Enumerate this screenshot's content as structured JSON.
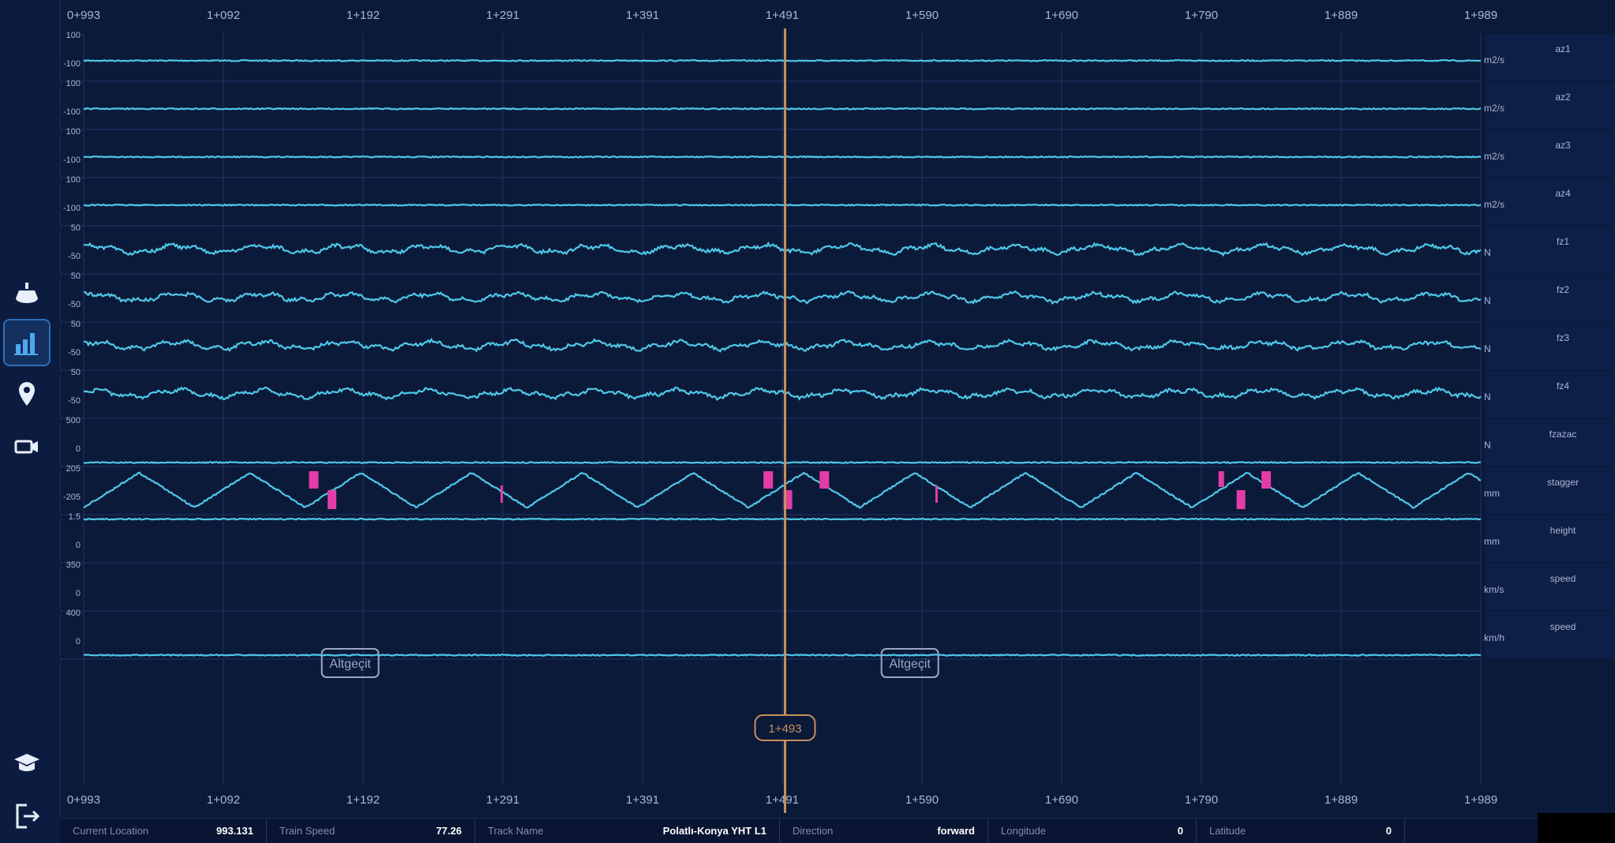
{
  "sidebar": {
    "items": [
      {
        "name": "hull-icon",
        "active": false
      },
      {
        "name": "bar-chart-icon",
        "active": true
      },
      {
        "name": "location-pin-icon",
        "active": false
      },
      {
        "name": "camera-icon",
        "active": false
      },
      {
        "name": "graduation-cap-icon",
        "active": false
      },
      {
        "name": "logout-icon",
        "active": false
      }
    ]
  },
  "colors": {
    "background": "#0c1a3a",
    "signal": "#4fc8e6",
    "cursor": "#c8905a",
    "highlight": "#e23ca6",
    "grid": "#1e3464",
    "text": "#aab6d2"
  },
  "chart_data": {
    "type": "line",
    "x_ticks": [
      "0+993",
      "1+092",
      "1+192",
      "1+291",
      "1+391",
      "1+491",
      "1+590",
      "1+690",
      "1+790",
      "1+889",
      "1+989"
    ],
    "xlim": [
      993,
      1989
    ],
    "cursor": {
      "position": 1493,
      "label": "1+493"
    },
    "annotations": [
      {
        "label": "Altgeçit",
        "position": 1183
      },
      {
        "label": "Altgeçit",
        "position": 1582
      }
    ],
    "tracks": [
      {
        "name": "az1",
        "unit": "m2/s",
        "tick_top": "100",
        "tick_bottom": "-100",
        "style": "flat",
        "baseline": 0.6
      },
      {
        "name": "az2",
        "unit": "m2/s",
        "tick_top": "100",
        "tick_bottom": "-100",
        "style": "flat",
        "baseline": 0.6
      },
      {
        "name": "az3",
        "unit": "m2/s",
        "tick_top": "100",
        "tick_bottom": "-100",
        "style": "flat",
        "baseline": 0.6
      },
      {
        "name": "az4",
        "unit": "m2/s",
        "tick_top": "100",
        "tick_bottom": "-100",
        "style": "flat",
        "baseline": 0.6
      },
      {
        "name": "fz1",
        "unit": "N",
        "tick_top": "50",
        "tick_bottom": "-50",
        "style": "noisy",
        "baseline": 0.5
      },
      {
        "name": "fz2",
        "unit": "N",
        "tick_top": "50",
        "tick_bottom": "-50",
        "style": "noisy",
        "baseline": 0.5
      },
      {
        "name": "fz3",
        "unit": "N",
        "tick_top": "50",
        "tick_bottom": "-50",
        "style": "noisy",
        "baseline": 0.5
      },
      {
        "name": "fz4",
        "unit": "N",
        "tick_top": "50",
        "tick_bottom": "-50",
        "style": "noisy",
        "baseline": 0.5
      },
      {
        "name": "fzazac",
        "unit": "N",
        "tick_top": "500",
        "tick_bottom": "0",
        "style": "flat",
        "baseline": 1.0
      },
      {
        "name": "stagger",
        "unit": "mm",
        "tick_top": "205",
        "tick_bottom": "-205",
        "style": "stagger",
        "baseline": 0.5
      },
      {
        "name": "height",
        "unit": "mm",
        "tick_top": "1.5",
        "tick_bottom": "0",
        "style": "flat",
        "baseline": 0.05
      },
      {
        "name": "speed",
        "unit": "km/s",
        "tick_top": "350",
        "tick_bottom": "0",
        "style": "none",
        "baseline": 0.5
      },
      {
        "name": "speed",
        "unit": "km/h",
        "tick_top": "400",
        "tick_bottom": "0",
        "style": "flat",
        "baseline": 1.0
      }
    ],
    "stagger_period": 79,
    "stagger_highlights": [
      {
        "position": 1157,
        "kind": "high"
      },
      {
        "position": 1170,
        "kind": "low"
      },
      {
        "position": 1291,
        "kind": "thin"
      },
      {
        "position": 1481,
        "kind": "high"
      },
      {
        "position": 1495,
        "kind": "low"
      },
      {
        "position": 1521,
        "kind": "high"
      },
      {
        "position": 1601,
        "kind": "thin"
      },
      {
        "position": 1804,
        "kind": "high-thin"
      },
      {
        "position": 1818,
        "kind": "low"
      },
      {
        "position": 1836,
        "kind": "high"
      }
    ]
  },
  "status": [
    {
      "label": "Current Location",
      "value": "993.131"
    },
    {
      "label": "Train Speed",
      "value": "77.26"
    },
    {
      "label": "Track Name",
      "value": "Polatlı-Konya YHT L1"
    },
    {
      "label": "Direction",
      "value": "forward"
    },
    {
      "label": "Longitude",
      "value": "0"
    },
    {
      "label": "Latitude",
      "value": "0"
    }
  ]
}
